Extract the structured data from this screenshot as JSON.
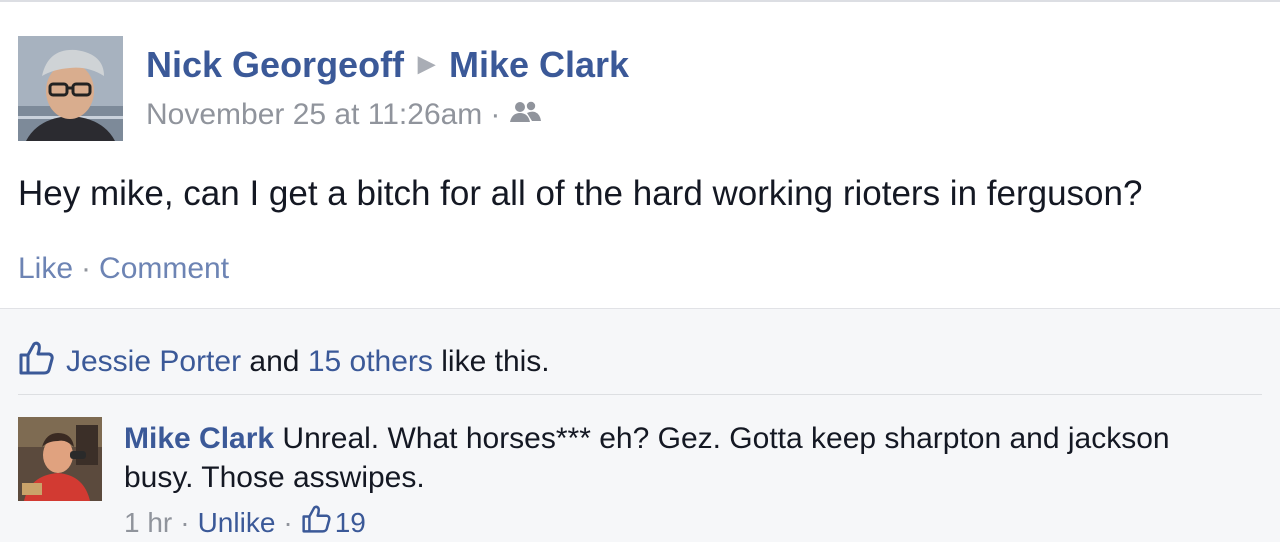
{
  "post": {
    "author": "Nick Georgeoff",
    "target": "Mike Clark",
    "timestamp": "November 25 at 11:26am",
    "separator": "·",
    "audience_icon": "friends-icon",
    "text": "Hey mike, can I get a bitch for all of the hard working rioters in ferguson?",
    "actions": {
      "like": "Like",
      "comment": "Comment",
      "separator": "·"
    }
  },
  "likes": {
    "name": "Jessie Porter",
    "and": "and",
    "others": "15 others",
    "suffix": "like this."
  },
  "comment": {
    "author": "Mike Clark",
    "text": "Unreal. What horses*** eh? Gez. Gotta keep sharpton and jackson busy. Those asswipes.",
    "time": "1 hr",
    "unlike": "Unlike",
    "separator": "·",
    "like_count": "19"
  },
  "colors": {
    "link": "#3b5998",
    "meta": "#90949c",
    "text": "#141823",
    "feedback_bg": "#f6f7f9"
  }
}
